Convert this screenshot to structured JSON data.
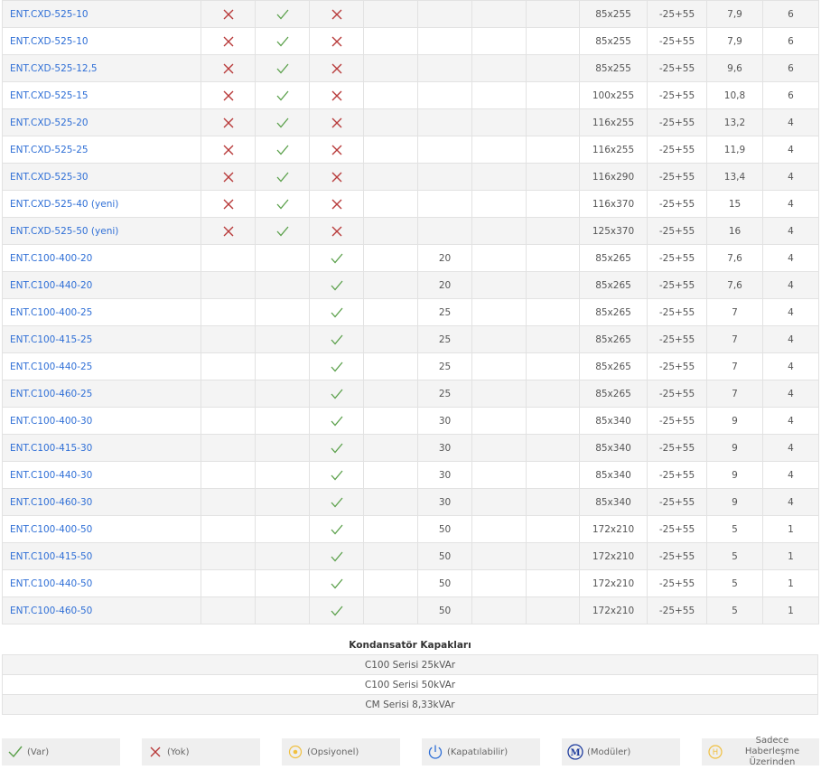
{
  "products": [
    {
      "model": "ENT.CXD-525-10",
      "c1": "x",
      "c2": "v",
      "c3": "x",
      "c4": "",
      "c5": "",
      "c6": "",
      "c7": "",
      "dim": "85x255",
      "temp": "-25+55",
      "w": "7,9",
      "q": "6"
    },
    {
      "model": "ENT.CXD-525-10",
      "c1": "x",
      "c2": "v",
      "c3": "x",
      "c4": "",
      "c5": "",
      "c6": "",
      "c7": "",
      "dim": "85x255",
      "temp": "-25+55",
      "w": "7,9",
      "q": "6"
    },
    {
      "model": "ENT.CXD-525-12,5",
      "c1": "x",
      "c2": "v",
      "c3": "x",
      "c4": "",
      "c5": "",
      "c6": "",
      "c7": "",
      "dim": "85x255",
      "temp": "-25+55",
      "w": "9,6",
      "q": "6"
    },
    {
      "model": "ENT.CXD-525-15",
      "c1": "x",
      "c2": "v",
      "c3": "x",
      "c4": "",
      "c5": "",
      "c6": "",
      "c7": "",
      "dim": "100x255",
      "temp": "-25+55",
      "w": "10,8",
      "q": "6"
    },
    {
      "model": "ENT.CXD-525-20",
      "c1": "x",
      "c2": "v",
      "c3": "x",
      "c4": "",
      "c5": "",
      "c6": "",
      "c7": "",
      "dim": "116x255",
      "temp": "-25+55",
      "w": "13,2",
      "q": "4"
    },
    {
      "model": "ENT.CXD-525-25",
      "c1": "x",
      "c2": "v",
      "c3": "x",
      "c4": "",
      "c5": "",
      "c6": "",
      "c7": "",
      "dim": "116x255",
      "temp": "-25+55",
      "w": "11,9",
      "q": "4"
    },
    {
      "model": "ENT.CXD-525-30",
      "c1": "x",
      "c2": "v",
      "c3": "x",
      "c4": "",
      "c5": "",
      "c6": "",
      "c7": "",
      "dim": "116x290",
      "temp": "-25+55",
      "w": "13,4",
      "q": "4"
    },
    {
      "model": "ENT.CXD-525-40 (yeni)",
      "c1": "x",
      "c2": "v",
      "c3": "x",
      "c4": "",
      "c5": "",
      "c6": "",
      "c7": "",
      "dim": "116x370",
      "temp": "-25+55",
      "w": "15",
      "q": "4"
    },
    {
      "model": "ENT.CXD-525-50 (yeni)",
      "c1": "x",
      "c2": "v",
      "c3": "x",
      "c4": "",
      "c5": "",
      "c6": "",
      "c7": "",
      "dim": "125x370",
      "temp": "-25+55",
      "w": "16",
      "q": "4"
    },
    {
      "model": "ENT.C100-400-20",
      "c1": "",
      "c2": "",
      "c3": "v",
      "c4": "",
      "c5": "20",
      "c6": "",
      "c7": "",
      "dim": "85x265",
      "temp": "-25+55",
      "w": "7,6",
      "q": "4"
    },
    {
      "model": "ENT.C100-440-20",
      "c1": "",
      "c2": "",
      "c3": "v",
      "c4": "",
      "c5": "20",
      "c6": "",
      "c7": "",
      "dim": "85x265",
      "temp": "-25+55",
      "w": "7,6",
      "q": "4"
    },
    {
      "model": "ENT.C100-400-25",
      "c1": "",
      "c2": "",
      "c3": "v",
      "c4": "",
      "c5": "25",
      "c6": "",
      "c7": "",
      "dim": "85x265",
      "temp": "-25+55",
      "w": "7",
      "q": "4"
    },
    {
      "model": "ENT.C100-415-25",
      "c1": "",
      "c2": "",
      "c3": "v",
      "c4": "",
      "c5": "25",
      "c6": "",
      "c7": "",
      "dim": "85x265",
      "temp": "-25+55",
      "w": "7",
      "q": "4"
    },
    {
      "model": "ENT.C100-440-25",
      "c1": "",
      "c2": "",
      "c3": "v",
      "c4": "",
      "c5": "25",
      "c6": "",
      "c7": "",
      "dim": "85x265",
      "temp": "-25+55",
      "w": "7",
      "q": "4"
    },
    {
      "model": "ENT.C100-460-25",
      "c1": "",
      "c2": "",
      "c3": "v",
      "c4": "",
      "c5": "25",
      "c6": "",
      "c7": "",
      "dim": "85x265",
      "temp": "-25+55",
      "w": "7",
      "q": "4"
    },
    {
      "model": "ENT.C100-400-30",
      "c1": "",
      "c2": "",
      "c3": "v",
      "c4": "",
      "c5": "30",
      "c6": "",
      "c7": "",
      "dim": "85x340",
      "temp": "-25+55",
      "w": "9",
      "q": "4"
    },
    {
      "model": "ENT.C100-415-30",
      "c1": "",
      "c2": "",
      "c3": "v",
      "c4": "",
      "c5": "30",
      "c6": "",
      "c7": "",
      "dim": "85x340",
      "temp": "-25+55",
      "w": "9",
      "q": "4"
    },
    {
      "model": "ENT.C100-440-30",
      "c1": "",
      "c2": "",
      "c3": "v",
      "c4": "",
      "c5": "30",
      "c6": "",
      "c7": "",
      "dim": "85x340",
      "temp": "-25+55",
      "w": "9",
      "q": "4"
    },
    {
      "model": "ENT.C100-460-30",
      "c1": "",
      "c2": "",
      "c3": "v",
      "c4": "",
      "c5": "30",
      "c6": "",
      "c7": "",
      "dim": "85x340",
      "temp": "-25+55",
      "w": "9",
      "q": "4"
    },
    {
      "model": "ENT.C100-400-50",
      "c1": "",
      "c2": "",
      "c3": "v",
      "c4": "",
      "c5": "50",
      "c6": "",
      "c7": "",
      "dim": "172x210",
      "temp": "-25+55",
      "w": "5",
      "q": "1"
    },
    {
      "model": "ENT.C100-415-50",
      "c1": "",
      "c2": "",
      "c3": "v",
      "c4": "",
      "c5": "50",
      "c6": "",
      "c7": "",
      "dim": "172x210",
      "temp": "-25+55",
      "w": "5",
      "q": "1"
    },
    {
      "model": "ENT.C100-440-50",
      "c1": "",
      "c2": "",
      "c3": "v",
      "c4": "",
      "c5": "50",
      "c6": "",
      "c7": "",
      "dim": "172x210",
      "temp": "-25+55",
      "w": "5",
      "q": "1"
    },
    {
      "model": "ENT.C100-460-50",
      "c1": "",
      "c2": "",
      "c3": "v",
      "c4": "",
      "c5": "50",
      "c6": "",
      "c7": "",
      "dim": "172x210",
      "temp": "-25+55",
      "w": "5",
      "q": "1"
    }
  ],
  "caps": {
    "title": "Kondansatör Kapakları",
    "items": [
      "C100 Serisi 25kVAr",
      "C100 Serisi 50kVAr",
      "CM Serisi 8,33kVAr"
    ]
  },
  "legend": {
    "var": "(Var)",
    "yok": "(Yok)",
    "opsiyonel": "(Opsiyonel)",
    "kapatilabilir": "(Kapatılabilir)",
    "moduler": "(Modüler)",
    "haberlesme_1": "Sadece Haberleşme",
    "haberlesme_2": "Üzerinden",
    "modular_glyph": "M",
    "h_glyph": "H"
  },
  "colors": {
    "link": "#2f6fd6",
    "check": "#5aa04a",
    "cross": "#b83a3a",
    "optional": "#f0c040",
    "power": "#2f6fd6",
    "modular": "#1e3c9e",
    "stripe": "#f4f4f4"
  }
}
